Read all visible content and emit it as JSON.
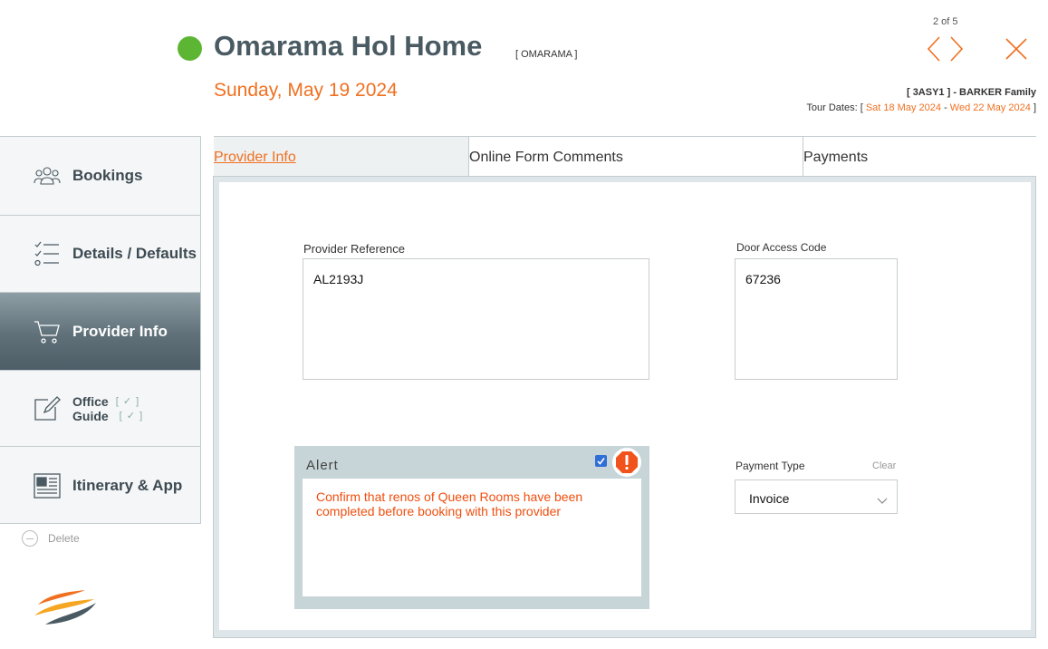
{
  "header": {
    "title": "Omarama Hol Home",
    "code_tag": "[ OMARAMA ]",
    "date": "Sunday, May 19 2024",
    "pager": "2 of 5",
    "family": "[ 3ASY1 ] - BARKER Family",
    "tour_dates_label": "Tour Dates: [",
    "tour_start": "Sat 18 May 2024",
    "tour_sep": "-",
    "tour_end": "Wed 22 May 2024",
    "tour_close": "]"
  },
  "sidebar": {
    "items": [
      {
        "label": "Bookings",
        "icon": "users-icon"
      },
      {
        "label": "Details / Defaults",
        "icon": "checklist-icon"
      },
      {
        "label": "Provider Info",
        "icon": "cart-icon"
      },
      {
        "label": "Office",
        "sublabel": "Guide",
        "icon": "edit-icon",
        "check_open": "[",
        "check_mark": "✓",
        "check_close": "]"
      },
      {
        "label": "Itinerary & App",
        "icon": "newspaper-icon"
      }
    ],
    "delete_label": "Delete"
  },
  "tabs": [
    {
      "label": "Provider Info",
      "active": true
    },
    {
      "label": "Online Form Comments",
      "active": false
    },
    {
      "label": "Payments",
      "active": false
    }
  ],
  "provider_ref": {
    "label": "Provider Reference",
    "value": "AL2193J"
  },
  "door_code": {
    "label": "Door Access Code",
    "value": "67236"
  },
  "alert": {
    "title": "Alert",
    "checked": true,
    "message": "Confirm that renos of Queen Rooms have been completed before booking with this provider"
  },
  "payment_type": {
    "label": "Payment Type",
    "value": "Invoice",
    "clear_label": "Clear"
  },
  "colors": {
    "accent": "#f07020",
    "status_green": "#5cb634",
    "alert_red": "#f04e0e"
  }
}
